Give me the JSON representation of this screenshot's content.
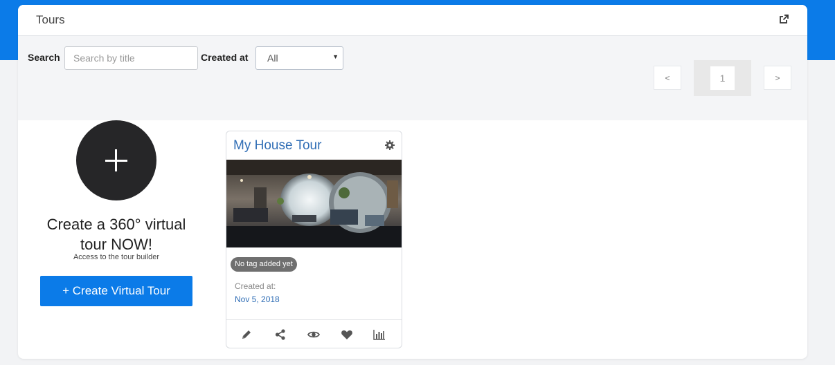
{
  "panel": {
    "title": "Tours"
  },
  "filters": {
    "search_label": "Search",
    "search_placeholder": "Search by title",
    "created_label": "Created at",
    "created_value": "All"
  },
  "pagination": {
    "prev": "<",
    "page": "1",
    "next": ">"
  },
  "create": {
    "heading_line1": "Create a 360° virtual",
    "heading_line2": "tour NOW!",
    "subtext": "Access to the tour builder",
    "button_label": "+ Create Virtual Tour"
  },
  "tours": [
    {
      "title": "My House Tour",
      "tag": "No tag added yet",
      "created_label": "Created at:",
      "created_date": "Nov 5, 2018"
    }
  ],
  "colors": {
    "brand_blue": "#0b7be8",
    "link_blue": "#2f6db5",
    "dark_circle": "#262628"
  },
  "icons": {
    "header": "external-link-icon",
    "card_settings": "gear-icon",
    "actions": [
      "pencil-icon",
      "share-icon",
      "eye-icon",
      "heart-icon",
      "bar-chart-icon"
    ]
  }
}
